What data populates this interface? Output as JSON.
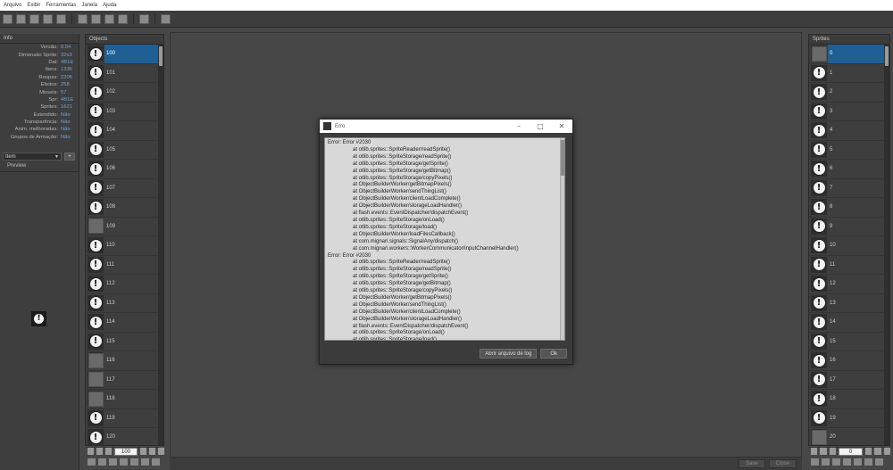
{
  "menu": [
    "Arquivo",
    "Exibir",
    "Ferramentas",
    "Janela",
    "Ajuda"
  ],
  "info": {
    "title": "Info",
    "rows": [
      {
        "k": "Versão:",
        "v": "8.54"
      },
      {
        "k": "Dimensão Sprite:",
        "v": "32x3"
      },
      {
        "k": "Dat:",
        "v": "4B1E"
      },
      {
        "k": "Itens:",
        "v": "1336"
      },
      {
        "k": "Roupas:",
        "v": "2205"
      },
      {
        "k": "Efeitos:",
        "v": "258"
      },
      {
        "k": "Misseis:",
        "v": "57"
      },
      {
        "k": "Spr:",
        "v": "4B1E"
      },
      {
        "k": "Sprites:",
        "v": "1621"
      },
      {
        "k": "Estendido:",
        "v": "Não"
      },
      {
        "k": "Transparência:",
        "v": "Não"
      },
      {
        "k": "Anim. melhoradas:",
        "v": "Não"
      },
      {
        "k": "Grupos de Armação:",
        "v": "Não"
      }
    ],
    "select_value": "Item",
    "select_btn": "+",
    "preview_label": "Preview"
  },
  "objects": {
    "title": "Objects",
    "rows": [
      {
        "id": "100",
        "icon": "warn"
      },
      {
        "id": "101",
        "icon": "warn"
      },
      {
        "id": "102",
        "icon": "warn"
      },
      {
        "id": "103",
        "icon": "warn"
      },
      {
        "id": "104",
        "icon": "warn"
      },
      {
        "id": "105",
        "icon": "warn"
      },
      {
        "id": "106",
        "icon": "warn"
      },
      {
        "id": "107",
        "icon": "warn"
      },
      {
        "id": "108",
        "icon": "warn"
      },
      {
        "id": "109",
        "icon": "blank"
      },
      {
        "id": "110",
        "icon": "warn"
      },
      {
        "id": "111",
        "icon": "warn"
      },
      {
        "id": "112",
        "icon": "warn"
      },
      {
        "id": "113",
        "icon": "warn"
      },
      {
        "id": "114",
        "icon": "warn"
      },
      {
        "id": "115",
        "icon": "warn"
      },
      {
        "id": "116",
        "icon": "blank"
      },
      {
        "id": "117",
        "icon": "blank"
      },
      {
        "id": "118",
        "icon": "blank"
      },
      {
        "id": "119",
        "icon": "warn"
      },
      {
        "id": "120",
        "icon": "warn"
      }
    ],
    "page_value": "100"
  },
  "sprites": {
    "title": "Sprites",
    "rows": [
      {
        "id": "0",
        "icon": "blank"
      },
      {
        "id": "1",
        "icon": "warn"
      },
      {
        "id": "2",
        "icon": "warn"
      },
      {
        "id": "3",
        "icon": "warn"
      },
      {
        "id": "4",
        "icon": "warn"
      },
      {
        "id": "5",
        "icon": "warn"
      },
      {
        "id": "6",
        "icon": "warn"
      },
      {
        "id": "7",
        "icon": "warn"
      },
      {
        "id": "8",
        "icon": "warn"
      },
      {
        "id": "9",
        "icon": "warn"
      },
      {
        "id": "10",
        "icon": "warn"
      },
      {
        "id": "11",
        "icon": "warn"
      },
      {
        "id": "12",
        "icon": "warn"
      },
      {
        "id": "13",
        "icon": "warn"
      },
      {
        "id": "14",
        "icon": "warn"
      },
      {
        "id": "15",
        "icon": "warn"
      },
      {
        "id": "16",
        "icon": "warn"
      },
      {
        "id": "17",
        "icon": "warn"
      },
      {
        "id": "18",
        "icon": "warn"
      },
      {
        "id": "19",
        "icon": "warn"
      },
      {
        "id": "20",
        "icon": "blank"
      }
    ],
    "page_value": "0"
  },
  "footer": {
    "save": "Save",
    "close": "Close"
  },
  "dialog": {
    "title": "Erro",
    "lines": [
      {
        "t": "err",
        "s": "Error: Error #2030"
      },
      {
        "t": "at",
        "s": "at otlib.sprites::SpriteReader/readSprite()"
      },
      {
        "t": "at",
        "s": "at otlib.sprites::SpriteStorage/readSprite()"
      },
      {
        "t": "at",
        "s": "at otlib.sprites::SpriteStorage/getSprite()"
      },
      {
        "t": "at",
        "s": "at otlib.sprites::SpriteStorage/getBitmap()"
      },
      {
        "t": "at",
        "s": "at otlib.sprites::SpriteStorage/copyPixels()"
      },
      {
        "t": "at",
        "s": "at ObjectBuilderWorker/getBitmapPixels()"
      },
      {
        "t": "at",
        "s": "at ObjectBuilderWorker/sendThingList()"
      },
      {
        "t": "at",
        "s": "at ObjectBuilderWorker/clientLoadComplete()"
      },
      {
        "t": "at",
        "s": "at ObjectBuilderWorker/storageLoadHandler()"
      },
      {
        "t": "at",
        "s": "at flash.events::EventDispatcher/dispatchEvent()"
      },
      {
        "t": "at",
        "s": "at otlib.sprites::SpriteStorage/onLoad()"
      },
      {
        "t": "at",
        "s": "at otlib.sprites::SpriteStorage/load()"
      },
      {
        "t": "at",
        "s": "at ObjectBuilderWorker/loadFilesCallback()"
      },
      {
        "t": "at",
        "s": "at com.mignari.signals::SignalAny/dispatch()"
      },
      {
        "t": "at",
        "s": "at com.mignari.workers::WorkerCommunicator/inputChannelHandler()"
      },
      {
        "t": "err",
        "s": "Error: Error #2030"
      },
      {
        "t": "at",
        "s": "at otlib.sprites::SpriteReader/readSprite()"
      },
      {
        "t": "at",
        "s": "at otlib.sprites::SpriteStorage/readSprite()"
      },
      {
        "t": "at",
        "s": "at otlib.sprites::SpriteStorage/getSprite()"
      },
      {
        "t": "at",
        "s": "at otlib.sprites::SpriteStorage/getBitmap()"
      },
      {
        "t": "at",
        "s": "at otlib.sprites::SpriteStorage/copyPixels()"
      },
      {
        "t": "at",
        "s": "at ObjectBuilderWorker/getBitmapPixels()"
      },
      {
        "t": "at",
        "s": "at ObjectBuilderWorker/sendThingList()"
      },
      {
        "t": "at",
        "s": "at ObjectBuilderWorker/clientLoadComplete()"
      },
      {
        "t": "at",
        "s": "at ObjectBuilderWorker/storageLoadHandler()"
      },
      {
        "t": "at",
        "s": "at flash.events::EventDispatcher/dispatchEvent()"
      },
      {
        "t": "at",
        "s": "at otlib.sprites::SpriteStorage/onLoad()"
      },
      {
        "t": "at",
        "s": "at otlib.sprites::SpriteStorage/load()"
      },
      {
        "t": "at",
        "s": "at ObjectBuilderWorker/loadFilesCallback()"
      }
    ],
    "btn_log": "Abrir arquivo de log",
    "btn_ok": "Ok"
  }
}
